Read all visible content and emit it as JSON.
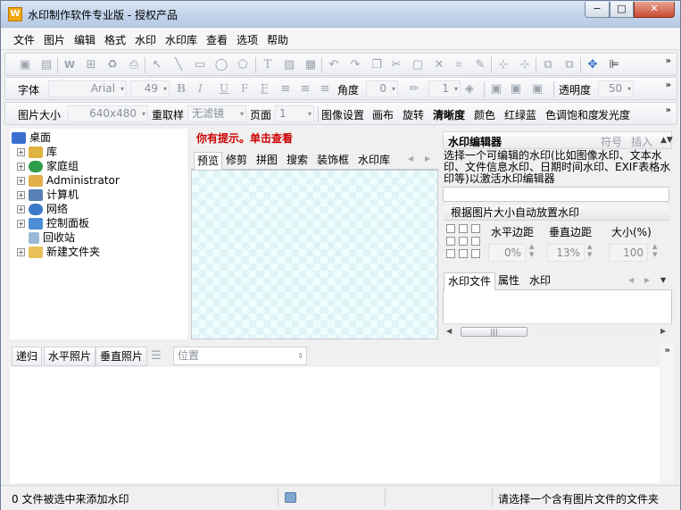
{
  "window": {
    "title": "水印制作软件专业版 - 授权产品",
    "app_icon_text": "W",
    "controls": {
      "minimize": "−",
      "maximize": "□",
      "close": "✕"
    }
  },
  "menu": [
    "文件",
    "图片",
    "编辑",
    "格式",
    "水印",
    "水印库",
    "查看",
    "选项",
    "帮助"
  ],
  "toolbar1": {
    "icons": [
      "save-icon",
      "save-as-icon",
      "watermark-icon",
      "batch-icon",
      "recycle-icon",
      "print-icon",
      "pointer-icon",
      "line-icon",
      "rectangle-icon",
      "ellipse-icon",
      "polygon-icon",
      "text-icon",
      "image-icon",
      "exif-icon",
      "undo-icon",
      "redo-icon",
      "copy-icon",
      "cut-icon",
      "paste-icon",
      "delete-icon",
      "crop-icon",
      "pen-icon",
      "align-h-icon",
      "align-v-icon",
      "group-icon",
      "ungroup-icon",
      "move-icon",
      "anchor-icon"
    ],
    "overflow": "»"
  },
  "toolbar2": {
    "font_label": "字体",
    "font_name": "Arial",
    "font_size": "49",
    "bold": "B",
    "italic": "I",
    "underline": "U",
    "strike": "F",
    "shadow": "F",
    "angle_label": "角度",
    "angle_value": "0",
    "line_value": "1",
    "opacity_label": "透明度",
    "opacity_value": "50",
    "overflow": "»"
  },
  "toolbar3": {
    "size_label": "图片大小",
    "size_value": "640x480",
    "resample_label": "重取样",
    "filter_value": "无滤镜",
    "page_label": "页面",
    "page_value": "1",
    "links": [
      "图像设置",
      "画布",
      "旋转",
      "清晰度",
      "颜色",
      "红绿蓝",
      "色调饱和度",
      "发光度"
    ],
    "overflow": "»"
  },
  "tree": {
    "items": [
      {
        "label": "桌面",
        "expander": "",
        "color": "#3a6fd0"
      },
      {
        "label": "库",
        "expander": "+",
        "color": "#e0b341"
      },
      {
        "label": "家庭组",
        "expander": "+",
        "color": "#2f9e4a"
      },
      {
        "label": "Administrator",
        "expander": "+",
        "color": "#e2b04a"
      },
      {
        "label": "计算机",
        "expander": "+",
        "color": "#5a7fb4"
      },
      {
        "label": "网络",
        "expander": "+",
        "color": "#3c7ac8"
      },
      {
        "label": "控制面板",
        "expander": "+",
        "color": "#4f8ed6"
      },
      {
        "label": "回收站",
        "expander": "",
        "color": "#9bb8d8"
      },
      {
        "label": "新建文件夹",
        "expander": "+",
        "color": "#e8c15a"
      }
    ]
  },
  "preview": {
    "hint": "你有提示。单击查看",
    "tabs": [
      "预览",
      "修剪",
      "拼图",
      "搜索",
      "装饰框",
      "水印库"
    ],
    "active_tab": 0
  },
  "watermark_editor": {
    "title": "水印编辑器",
    "symbol": "符号",
    "insert": "插入",
    "description": "选择一个可编辑的水印(比如图像水印、文本水印、文件信息水印、日期时间水印、EXIF表格水印等)以激活水印编辑器",
    "auto_resize": "根据图片大小自动放置水印",
    "h_margin_label": "水平边距",
    "v_margin_label": "垂直边距",
    "size_label": "大小(%)",
    "h_margin_value": "0%",
    "v_margin_value": "13%",
    "size_value": "100",
    "bottom_tabs": [
      "水印文件",
      "属性",
      "水印"
    ]
  },
  "lower_toolbar": {
    "buttons": [
      "递归",
      "水平照片",
      "垂直照片"
    ],
    "position_placeholder": "位置",
    "overflow": "»"
  },
  "status": {
    "left": "0 文件被选中来添加水印",
    "right": "请选择一个含有图片文件的文件夹"
  }
}
